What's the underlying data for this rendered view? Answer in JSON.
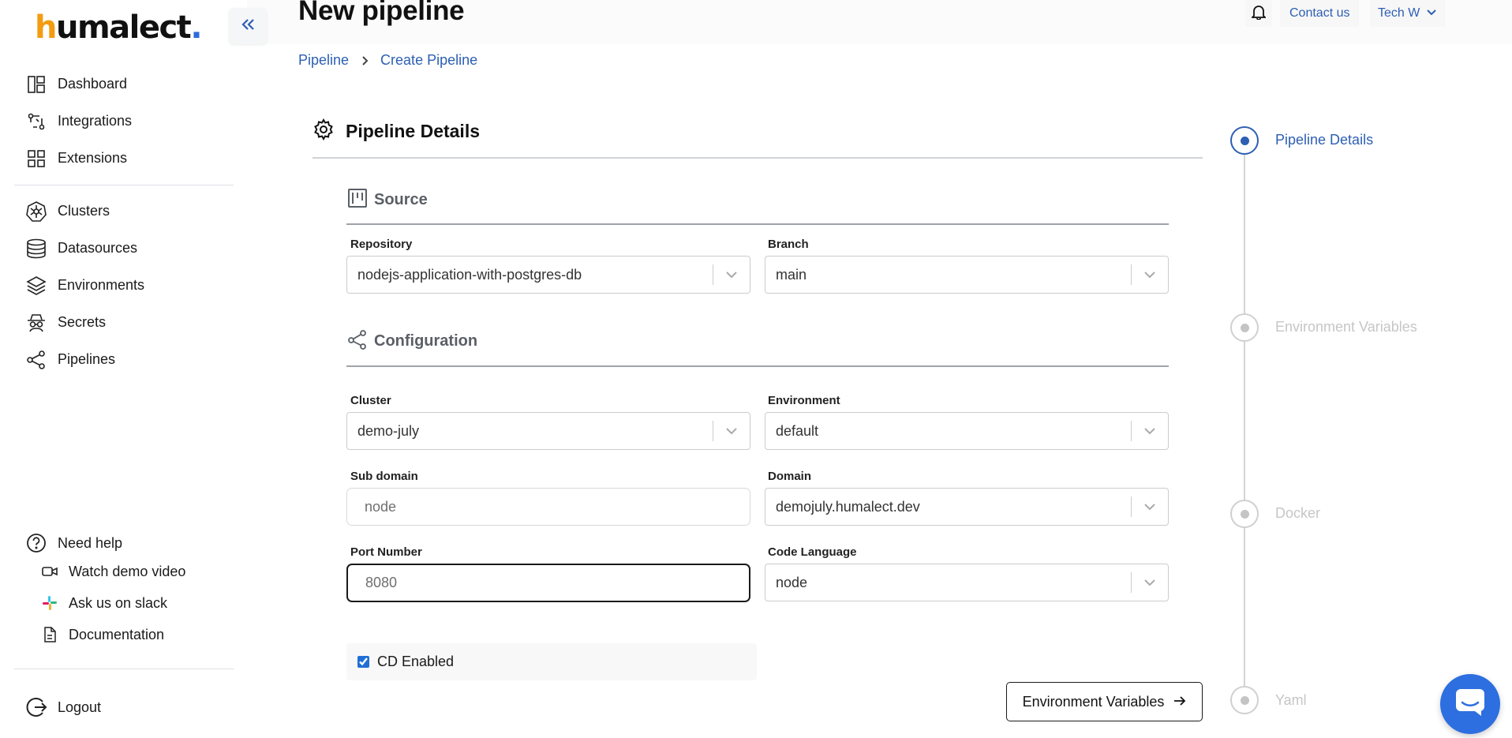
{
  "brand": {
    "logo_text_h": "h",
    "logo_text_rest": "umalect",
    "logo_dot": ".",
    "accent": "#2d5fb3",
    "logo_orange": "#f39c12"
  },
  "page": {
    "title": "New pipeline"
  },
  "header": {
    "contact": "Contact us",
    "user": "Tech W"
  },
  "breadcrumb": {
    "items": [
      "Pipeline",
      "Create Pipeline"
    ]
  },
  "sidebar": {
    "items": [
      {
        "label": "Dashboard",
        "icon": "dashboard-icon"
      },
      {
        "label": "Integrations",
        "icon": "integrations-icon"
      },
      {
        "label": "Extensions",
        "icon": "extensions-icon"
      },
      {
        "label": "Clusters",
        "icon": "clusters-icon"
      },
      {
        "label": "Datasources",
        "icon": "database-icon"
      },
      {
        "label": "Environments",
        "icon": "layers-icon"
      },
      {
        "label": "Secrets",
        "icon": "secret-agent-icon"
      },
      {
        "label": "Pipelines",
        "icon": "share-nodes-icon"
      }
    ],
    "help": {
      "title": "Need help",
      "links": [
        {
          "label": "Watch demo video",
          "icon": "video-icon"
        },
        {
          "label": "Ask us on slack",
          "icon": "slack-icon"
        },
        {
          "label": "Documentation",
          "icon": "document-icon"
        }
      ]
    },
    "logout": "Logout"
  },
  "form": {
    "section_title": "Pipeline Details",
    "source_title": "Source",
    "config_title": "Configuration",
    "repository": {
      "label": "Repository",
      "value": "nodejs-application-with-postgres-db"
    },
    "branch": {
      "label": "Branch",
      "value": "main"
    },
    "cluster": {
      "label": "Cluster",
      "value": "demo-july"
    },
    "environment": {
      "label": "Environment",
      "value": "default"
    },
    "subdomain": {
      "label": "Sub domain",
      "placeholder": "node"
    },
    "domain": {
      "label": "Domain",
      "value": "demojuly.humalect.dev"
    },
    "port": {
      "label": "Port Number",
      "placeholder": "8080"
    },
    "code_language": {
      "label": "Code Language",
      "value": "node"
    },
    "cd_enabled": {
      "label": "CD Enabled",
      "checked": true
    },
    "next_button": "Environment Variables"
  },
  "stepper": {
    "steps": [
      {
        "label": "Pipeline Details",
        "active": true
      },
      {
        "label": "Environment Variables",
        "active": false
      },
      {
        "label": "Docker",
        "active": false
      },
      {
        "label": "Yaml",
        "active": false
      }
    ]
  }
}
